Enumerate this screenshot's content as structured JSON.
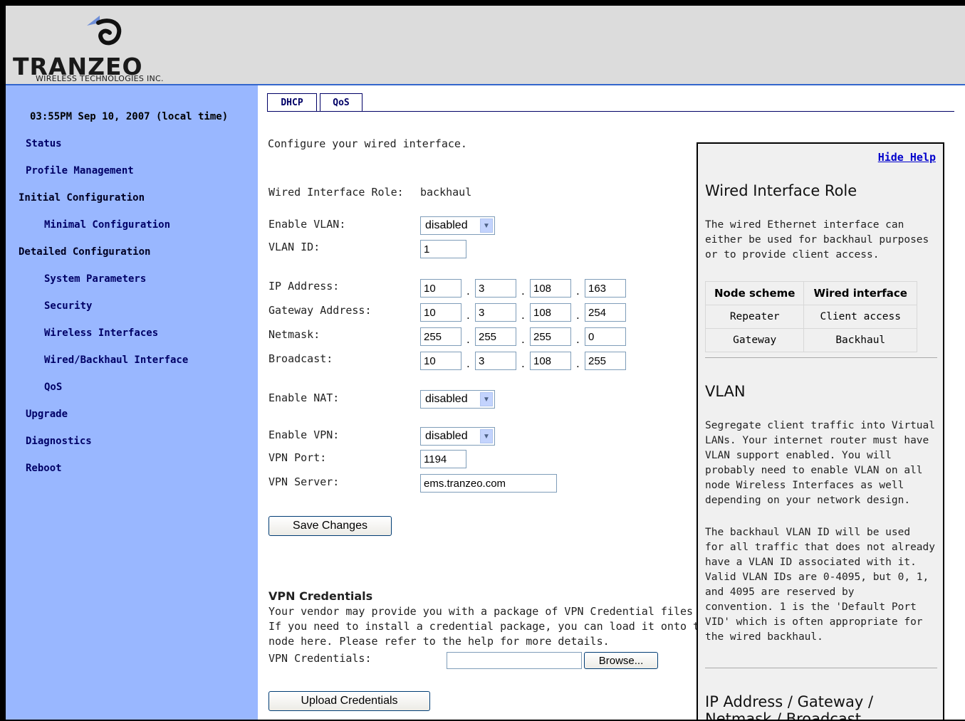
{
  "logo": {
    "name": "TRANZEO",
    "subtitle": "WIRELESS TECHNOLOGIES INC."
  },
  "sidebar": {
    "time": "03:55PM Sep 10, 2007 (local time)",
    "items": [
      {
        "label": "Status"
      },
      {
        "label": "Profile Management"
      },
      {
        "label": "Initial Configuration"
      },
      {
        "label": "Minimal Configuration"
      },
      {
        "label": "Detailed Configuration"
      },
      {
        "label": "System Parameters"
      },
      {
        "label": "Security"
      },
      {
        "label": "Wireless Interfaces"
      },
      {
        "label": "Wired/Backhaul Interface"
      },
      {
        "label": "QoS"
      },
      {
        "label": "Upgrade"
      },
      {
        "label": "Diagnostics"
      },
      {
        "label": "Reboot"
      }
    ]
  },
  "tabs": [
    {
      "label": "DHCP"
    },
    {
      "label": "QoS"
    }
  ],
  "form": {
    "intro": "Configure your wired interface.",
    "role_label": "Wired Interface Role:",
    "role_value": "backhaul",
    "vlan_label": "Enable VLAN:",
    "vlan_value": "disabled",
    "vlan_id_label": "VLAN ID:",
    "vlan_id_value": "1",
    "ip_label": "IP Address:",
    "ip": [
      "10",
      "3",
      "108",
      "163"
    ],
    "gw_label": "Gateway Address:",
    "gw": [
      "10",
      "3",
      "108",
      "254"
    ],
    "mask_label": "Netmask:",
    "mask": [
      "255",
      "255",
      "255",
      "0"
    ],
    "bc_label": "Broadcast:",
    "bc": [
      "10",
      "3",
      "108",
      "255"
    ],
    "nat_label": "Enable NAT:",
    "nat_value": "disabled",
    "vpn_label": "Enable VPN:",
    "vpn_value": "disabled",
    "vpn_port_label": "VPN Port:",
    "vpn_port_value": "1194",
    "vpn_server_label": "VPN Server:",
    "vpn_server_value": "ems.tranzeo.com",
    "save_label": "Save Changes"
  },
  "credentials": {
    "title": "VPN Credentials",
    "line1": "Your vendor may provide you with a package of VPN Credential files",
    "line2": "If you need to install a credential package, you can load it onto the",
    "line3": "node here. Please refer to the help for more details.",
    "field_label": "VPN Credentials:",
    "browse_label": "Browse...",
    "upload_label": "Upload Credentials"
  },
  "help": {
    "hide_label": "Hide Help",
    "role_title": "Wired Interface Role",
    "role_text": [
      "The wired Ethernet interface can",
      "either be used for backhaul purposes",
      "or to provide client access."
    ],
    "table_head": [
      "Node scheme",
      "Wired interface"
    ],
    "table_rows": [
      [
        "Repeater",
        "Client access"
      ],
      [
        "Gateway",
        "Backhaul"
      ]
    ],
    "vlan_title": "VLAN",
    "vlan_text": [
      "Segregate client traffic into Virtual",
      "LANs. Your internet router must have",
      "VLAN support enabled. You will",
      "probably need to enable VLAN on all",
      "node Wireless Interfaces as well",
      "depending on your network design."
    ],
    "vlan_text2": [
      "The backhaul VLAN ID will be used",
      "for all traffic that does not already",
      "have a VLAN ID associated with it.",
      "Valid VLAN IDs are 0-4095, but 0, 1,",
      "and 4095 are reserved by",
      "convention. 1 is the 'Default Port",
      "VID' which is often appropriate for",
      "the wired backhaul."
    ],
    "ip_title_1": "IP Address / Gateway /",
    "ip_title_2": "Netmask / Broadcast"
  }
}
